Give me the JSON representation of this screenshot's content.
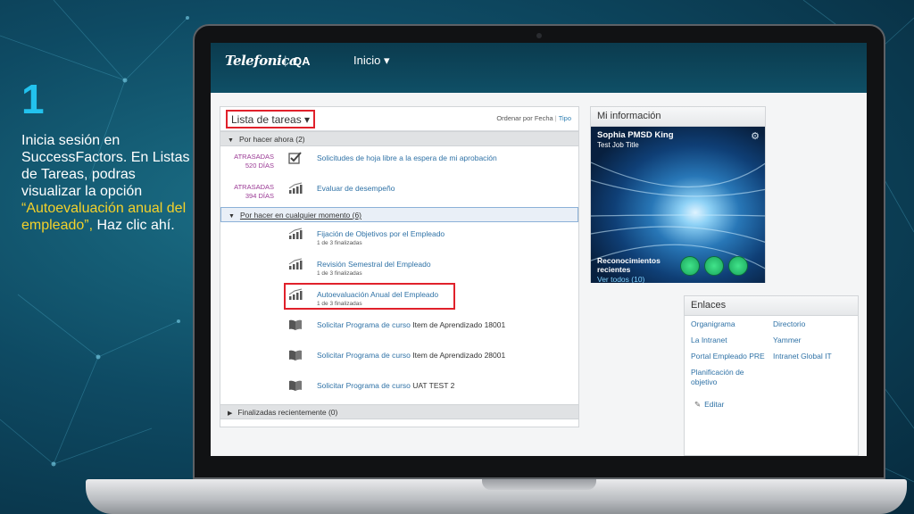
{
  "slide": {
    "step": "1",
    "text_before": "Inicia sesión en SuccessFactors. En Listas de Tareas, podras visualizar la opción ",
    "text_highlight": "“Autoevaluación anual del empleado”,",
    "text_after": " Haz clic ahí."
  },
  "header": {
    "logo": "Telefonica",
    "separator": "|",
    "env": "QA",
    "nav_home": "Inicio ▾"
  },
  "tasks": {
    "title": "Lista de tareas ▾",
    "sort_label": "Ordenar por Fecha",
    "sort_sep": "|",
    "sort_link": "Tipo",
    "groups": [
      {
        "label": "Por hacer ahora (2)"
      },
      {
        "label": "Por hacer en cualquier momento (6)"
      },
      {
        "label": "Finalizadas recientemente (0)"
      }
    ],
    "rows": [
      {
        "status": "ATRASADAS",
        "days": "520 DÍAS",
        "link": "Solicitudes de hoja libre a la espera de mi aprobación",
        "plain": "",
        "sub": "",
        "icon": "checkbox-icon"
      },
      {
        "status": "ATRASADAS",
        "days": "394 DÍAS",
        "link": "Evaluar de desempeño",
        "plain": "",
        "sub": "",
        "icon": "performance-chart-icon"
      },
      {
        "status": "",
        "days": "",
        "link": "Fijación de Objetivos por el Empleado",
        "plain": "",
        "sub": "1 de 3 finalizadas",
        "icon": "performance-chart-icon"
      },
      {
        "status": "",
        "days": "",
        "link": "Revisión Semestral del Empleado",
        "plain": "",
        "sub": "1 de 3 finalizadas",
        "icon": "performance-chart-icon"
      },
      {
        "status": "",
        "days": "",
        "link": "Autoevaluación Anual del Empleado",
        "plain": "",
        "sub": "1 de 3 finalizadas",
        "icon": "performance-chart-icon"
      },
      {
        "status": "",
        "days": "",
        "link": "Solicitar Programa de curso",
        "plain": " Item de Aprendizado 18001",
        "sub": "",
        "icon": "book-icon"
      },
      {
        "status": "",
        "days": "",
        "link": "Solicitar Programa de curso",
        "plain": " Item de Aprendizado 28001",
        "sub": "",
        "icon": "book-icon"
      },
      {
        "status": "",
        "days": "",
        "link": "Solicitar Programa de curso",
        "plain": " UAT TEST 2",
        "sub": "",
        "icon": "book-icon"
      }
    ]
  },
  "myinfo": {
    "title": "Mi información",
    "name": "Sophia PMSD King",
    "job": "Test Job Title",
    "recognitions": "Reconocimientos recientes",
    "view_all": "Ver todos (10)"
  },
  "links": {
    "title": "Enlaces",
    "items": [
      "Organigrama",
      "Directorio",
      "La Intranet",
      "Yammer",
      "Portal Empleado PRE",
      "Intranet Global IT",
      "Planificación de objetivo"
    ],
    "edit": "Editar"
  },
  "colors": {
    "accent": "#22c2ee",
    "highlight": "#f4d12a",
    "link": "#2f72a6",
    "overdue": "#9b3a95",
    "callout": "#e0212b"
  }
}
